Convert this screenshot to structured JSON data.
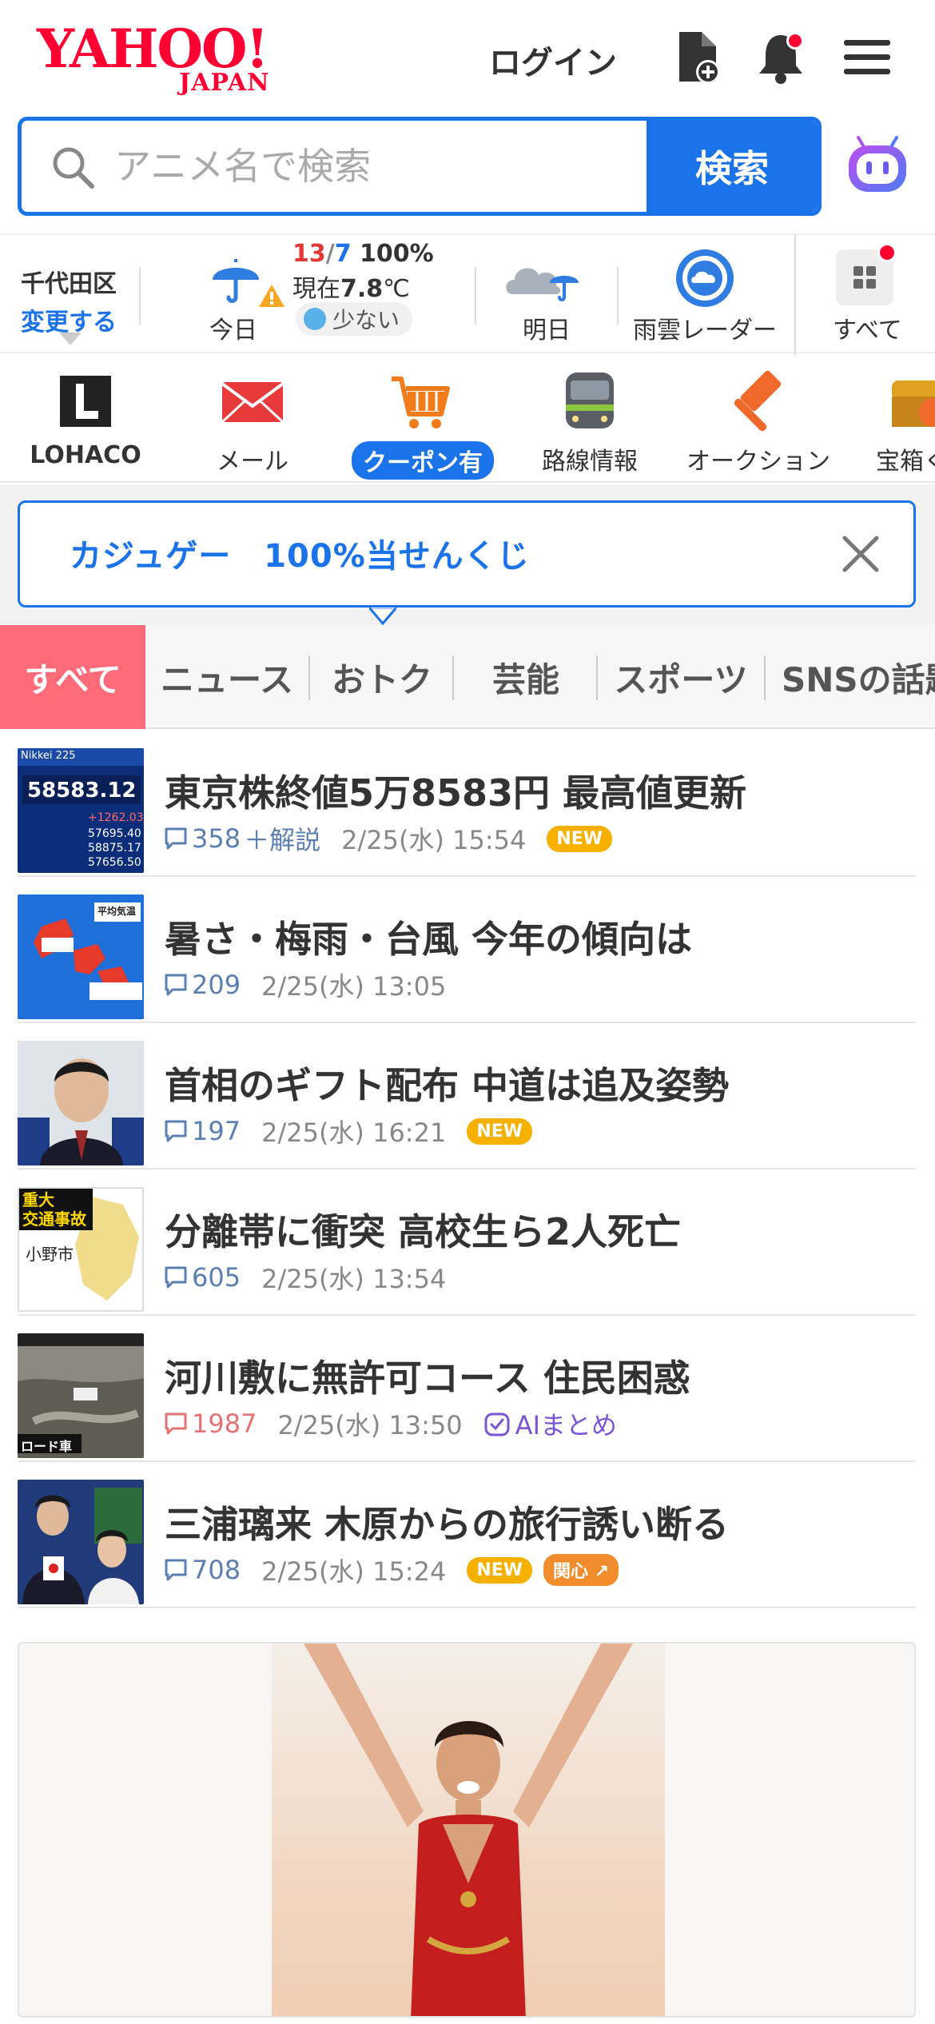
{
  "header": {
    "logo_main": "YAHOO!",
    "logo_sub": "JAPAN",
    "login_label": "ログイン"
  },
  "search": {
    "placeholder": "アニメ名で検索",
    "button_label": "検索"
  },
  "weather": {
    "area_name": "千代田区",
    "area_change": "変更する",
    "today_label": "今日",
    "temp_high": "13",
    "temp_sep": "/",
    "temp_low": "7",
    "rain_chance": "100%",
    "now_prefix": "現在",
    "now_temp": "7.8",
    "now_unit": "℃",
    "pollen": "少ない",
    "tomorrow_label": "明日",
    "radar_label": "雨雲レーダー",
    "all_label": "すべて"
  },
  "services": [
    {
      "label": "LOHACO",
      "icon": "lohaco-icon"
    },
    {
      "label": "メール",
      "icon": "mail-icon"
    },
    {
      "label": "クーポン有",
      "icon": "shopping-cart-icon"
    },
    {
      "label": "路線情報",
      "icon": "train-icon"
    },
    {
      "label": "オークション",
      "icon": "auction-hammer-icon"
    },
    {
      "label": "宝箱く",
      "icon": "treasure-box-icon"
    }
  ],
  "promo": {
    "text": "カジュゲー　100%当せんくじ"
  },
  "tabs": [
    "すべて",
    "ニュース",
    "おトク",
    "芸能",
    "スポーツ",
    "SNSの話題"
  ],
  "news": [
    {
      "headline": "東京株終値5万8583円 最高値更新",
      "comments": "358",
      "extra": "＋解説",
      "time": "2/25(水) 15:54",
      "badge": "NEW",
      "thumb_label": "58583.12",
      "thumb_sub": "Nikkei 225"
    },
    {
      "headline": "暑さ・梅雨・台風 今年の傾向は",
      "comments": "209",
      "time": "2/25(水) 13:05",
      "thumb_label": "平均気温"
    },
    {
      "headline": "首相のギフト配布 中道は追及姿勢",
      "comments": "197",
      "time": "2/25(水) 16:21",
      "badge": "NEW"
    },
    {
      "headline": "分離帯に衝突 高校生ら2人死亡",
      "comments": "605",
      "time": "2/25(水) 13:54",
      "thumb_label1": "重大",
      "thumb_label2": "交通事故",
      "thumb_label3": "小野市"
    },
    {
      "headline": "河川敷に無許可コース 住民困惑",
      "comments": "1987",
      "time": "2/25(水) 13:50",
      "ai_label": "AIまとめ",
      "thumb_label": "ロード車"
    },
    {
      "headline": "三浦璃来 木原からの旅行誘い断る",
      "comments": "708",
      "time": "2/25(水) 15:24",
      "badge": "NEW",
      "badge2": "関心"
    }
  ],
  "colors": {
    "brand_red": "#ff0033",
    "accent_blue": "#1a73e8",
    "tab_active": "#ff6b78",
    "new_badge": "#f6b100"
  }
}
